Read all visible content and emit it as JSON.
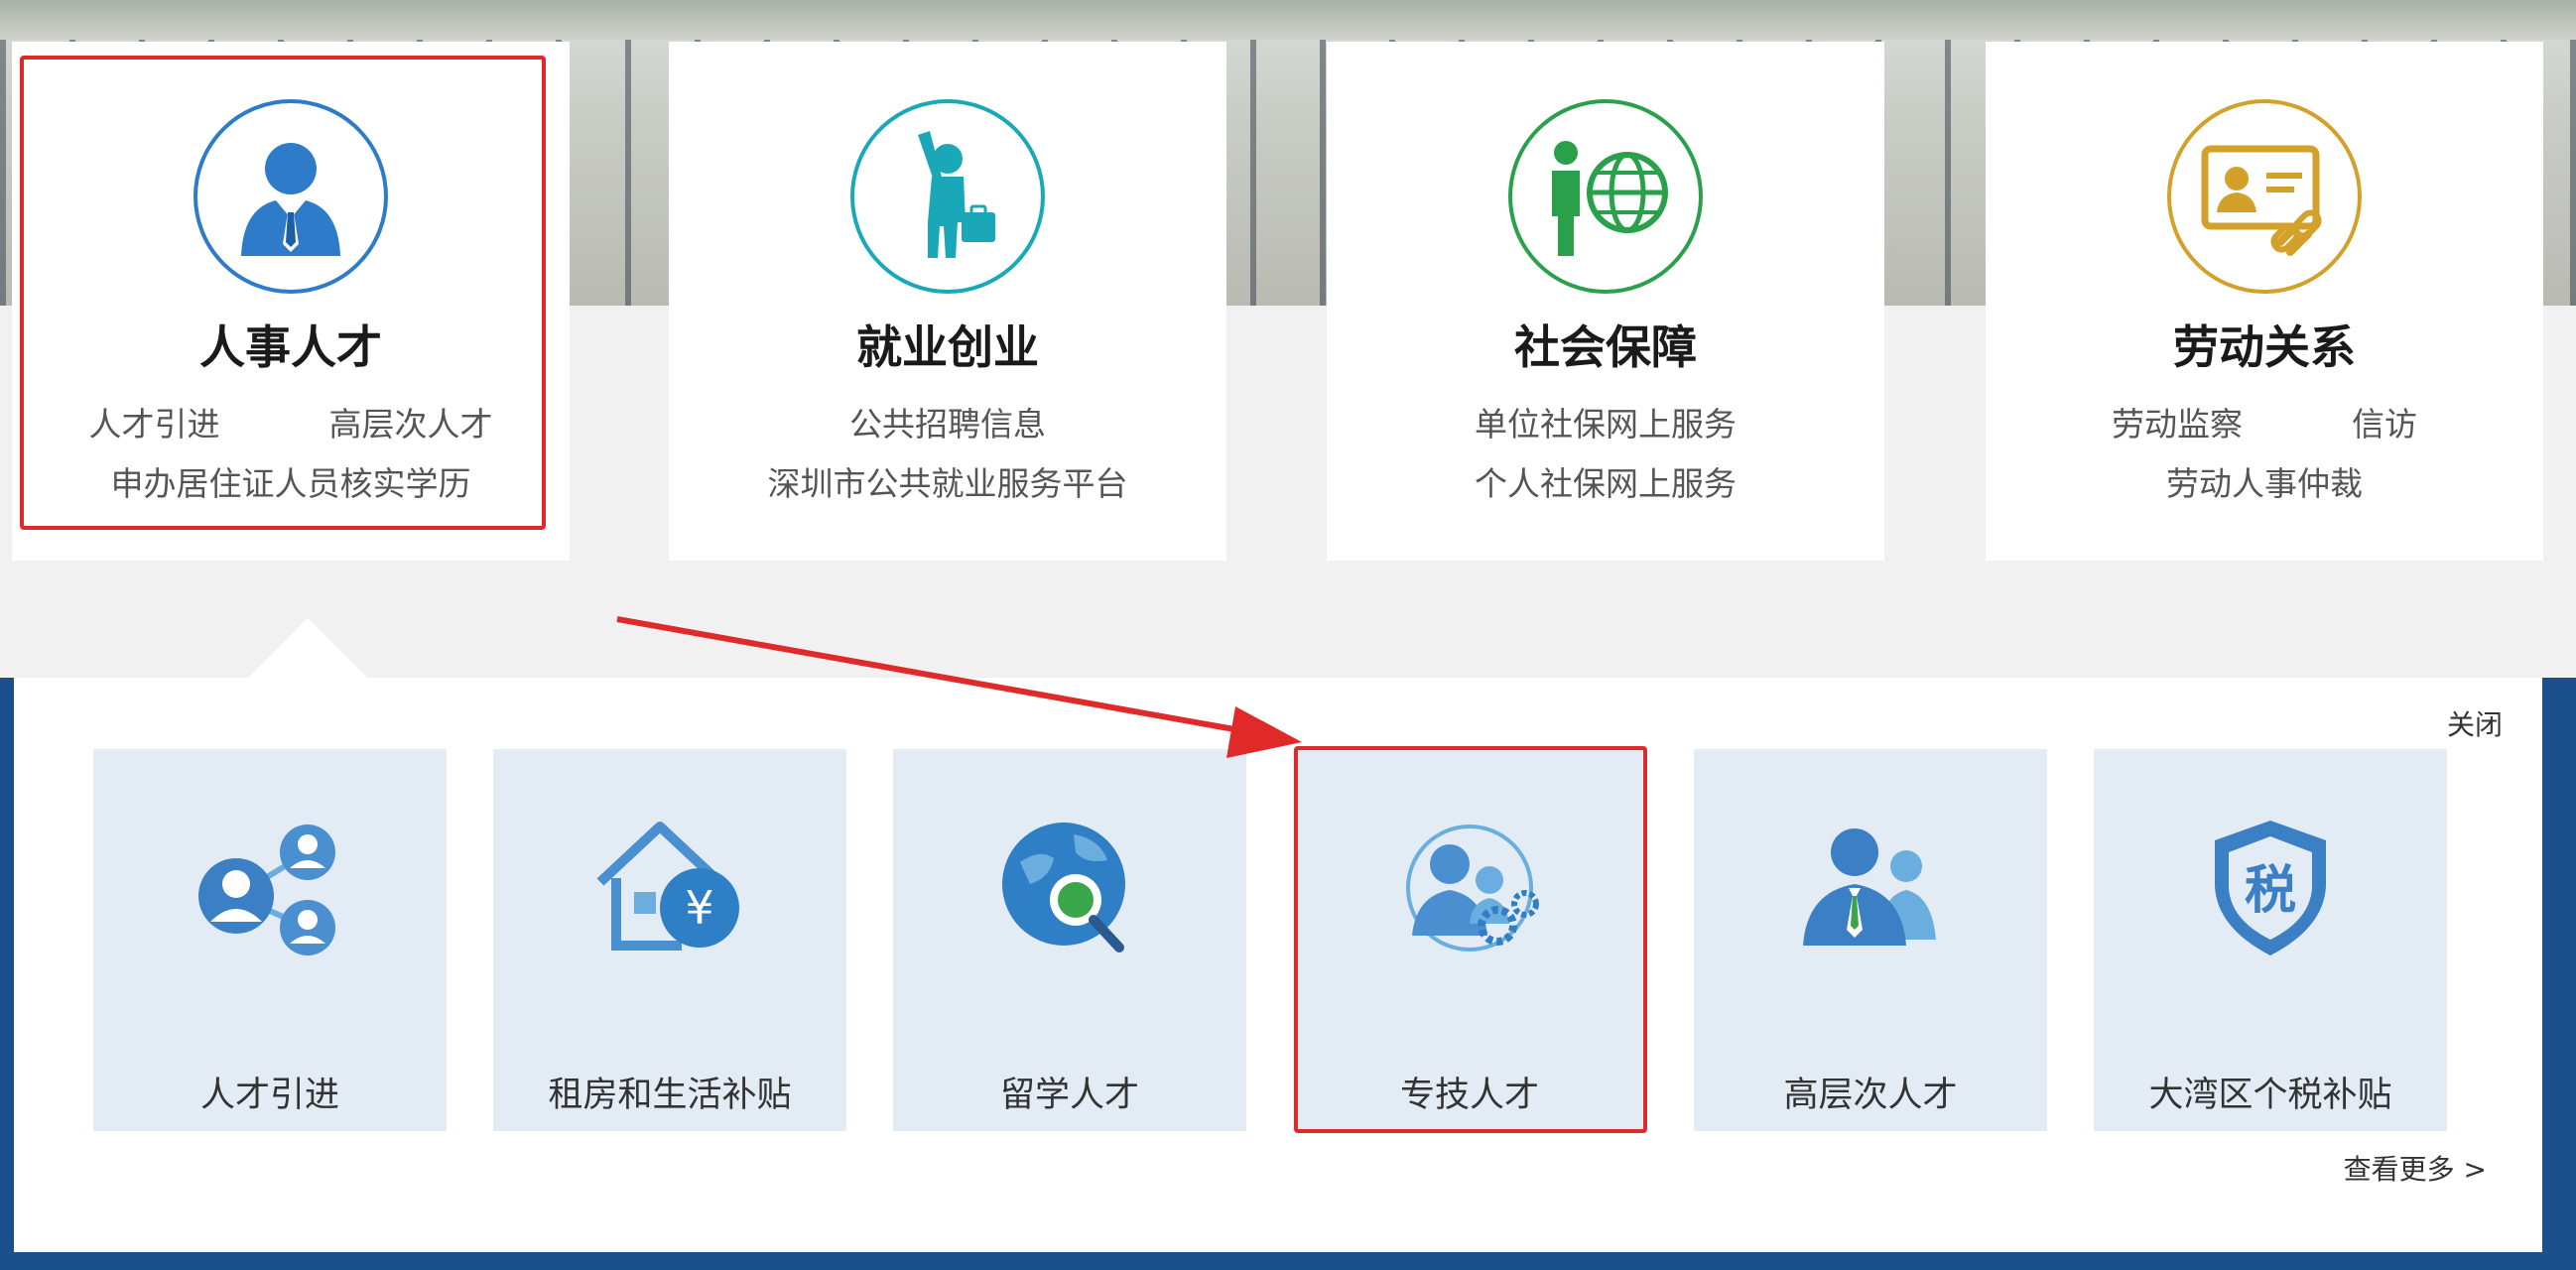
{
  "categories": [
    {
      "title": "人事人才",
      "links": [
        [
          "人才引进",
          "高层次人才"
        ],
        [
          "申办居住证人员核实学历"
        ]
      ],
      "icon": "businessman-icon"
    },
    {
      "title": "就业创业",
      "links": [
        [
          "公共招聘信息"
        ],
        [
          "深圳市公共就业服务平台"
        ]
      ],
      "icon": "job-seeker-icon"
    },
    {
      "title": "社会保障",
      "links": [
        [
          "单位社保网上服务"
        ],
        [
          "个人社保网上服务"
        ]
      ],
      "icon": "globe-person-icon"
    },
    {
      "title": "劳动关系",
      "links": [
        [
          "劳动监察",
          "信访"
        ],
        [
          "劳动人事仲裁"
        ]
      ],
      "icon": "id-card-link-icon"
    }
  ],
  "panel": {
    "close_label": "关闭",
    "more_label": "查看更多 >",
    "tiles": [
      {
        "label": "人才引进",
        "icon": "talent-network-icon"
      },
      {
        "label": "租房和生活补贴",
        "icon": "housing-subsidy-icon"
      },
      {
        "label": "留学人才",
        "icon": "globe-search-icon"
      },
      {
        "label": "专技人才",
        "icon": "tech-talent-gear-icon"
      },
      {
        "label": "高层次人才",
        "icon": "senior-talent-icon"
      },
      {
        "label": "大湾区个税补贴",
        "icon": "tax-shield-icon"
      }
    ]
  },
  "colors": {
    "accent": "#2d7bc9",
    "teal": "#1aa8b8",
    "green": "#2aa04a",
    "gold": "#d3a12a",
    "highlight": "#e02a2a",
    "tile_bg": "#e3ebf4"
  }
}
